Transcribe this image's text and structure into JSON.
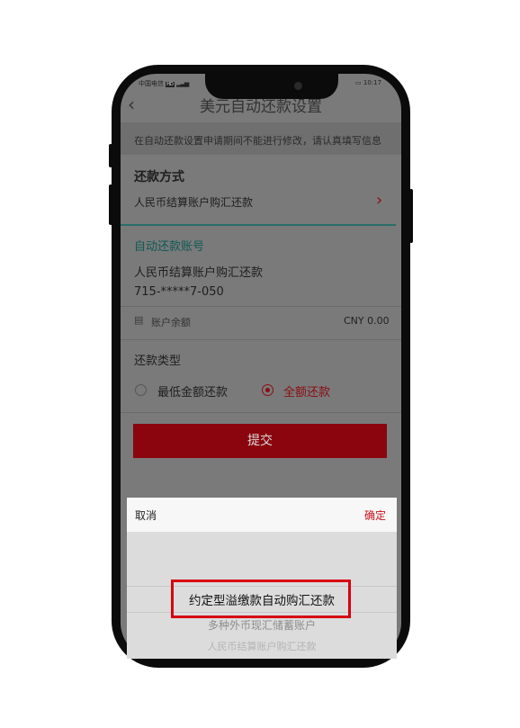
{
  "status_bar": {
    "carrier": "中国电信",
    "network": "HD",
    "time": "10:17"
  },
  "header": {
    "title": "美元自动还款设置",
    "back_icon": "chevron-left-icon"
  },
  "notice": "在自动还款设置申请期间不能进行修改，请认真填写信息",
  "repayment_method": {
    "section_title": "还款方式",
    "value": "人民币结算账户购汇还款",
    "chevron_icon": "chevron-right-icon"
  },
  "auto_account": {
    "section_title": "自动还款账号",
    "account_type": "人民币结算账户购汇还款",
    "account_number": "715-*****7-050",
    "balance_icon": "wallet-icon",
    "balance_label": "账户余额",
    "balance_value": "CNY 0.00"
  },
  "repayment_type": {
    "section_title": "还款类型",
    "options": [
      {
        "label": "最低金额还款",
        "selected": false
      },
      {
        "label": "全额还款",
        "selected": true
      }
    ]
  },
  "submit_label": "提交",
  "picker": {
    "cancel_label": "取消",
    "confirm_label": "确定",
    "options": [
      "约定型溢缴款自动购汇还款",
      "多种外币现汇储蓄账户",
      "人民币结算账户购汇还款"
    ],
    "highlight_color": "#d7000f"
  },
  "colors": {
    "brand_red": "#8a050d",
    "teal": "#0f5a55"
  }
}
